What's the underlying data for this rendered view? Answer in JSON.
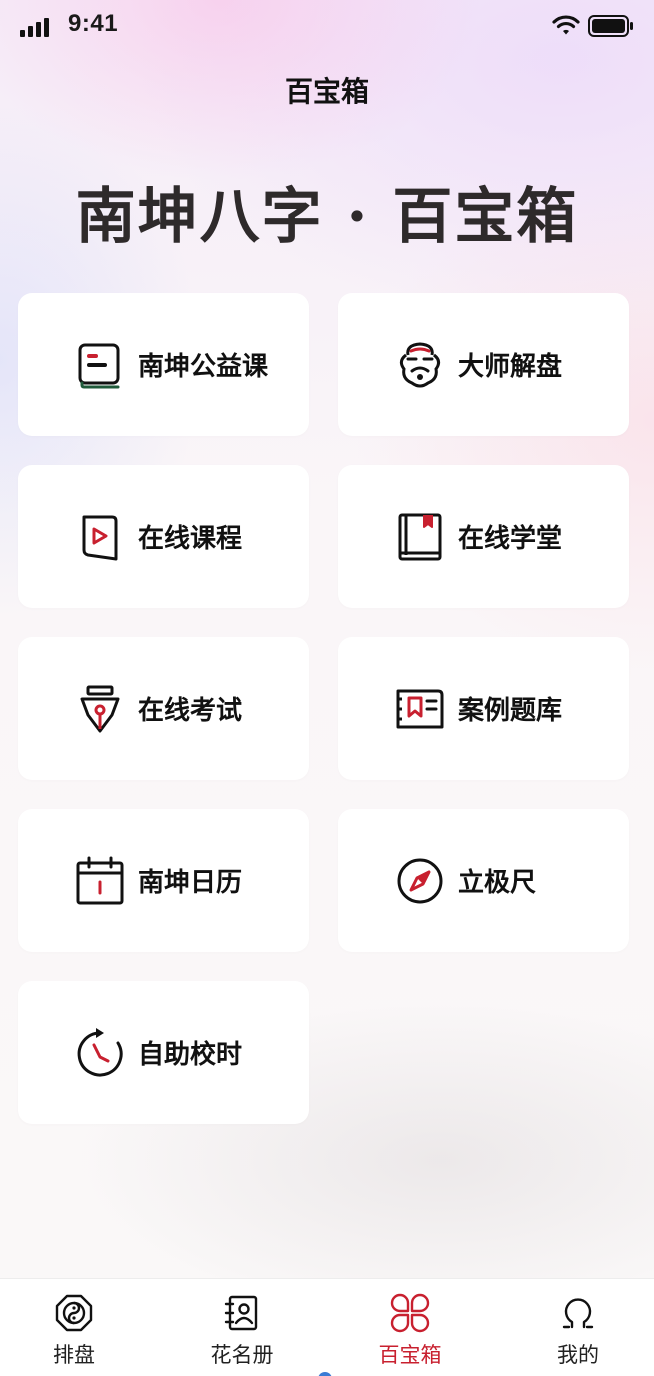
{
  "status_bar": {
    "time": "9:41"
  },
  "header": {
    "title": "百宝箱"
  },
  "hero": {
    "title": "南坤八字 · 百宝箱"
  },
  "colors": {
    "accent": "#c8202f",
    "text": "#111111",
    "hero_text": "#2e2a2b",
    "card_bg": "#ffffff"
  },
  "grid": {
    "items": [
      {
        "label": "南坤公益课",
        "icon": "book-green-icon"
      },
      {
        "label": "大师解盘",
        "icon": "master-face-icon"
      },
      {
        "label": "在线课程",
        "icon": "video-course-icon"
      },
      {
        "label": "在线学堂",
        "icon": "bookmark-book-icon"
      },
      {
        "label": "在线考试",
        "icon": "pen-nib-icon"
      },
      {
        "label": "案例题库",
        "icon": "question-bank-icon"
      },
      {
        "label": "南坤日历",
        "icon": "calendar-icon"
      },
      {
        "label": "立极尺",
        "icon": "compass-icon"
      },
      {
        "label": "自助校时",
        "icon": "clock-refresh-icon"
      }
    ]
  },
  "tabbar": {
    "tabs": [
      {
        "label": "排盘",
        "icon": "bagua-icon",
        "active": false
      },
      {
        "label": "花名册",
        "icon": "contacts-icon",
        "active": false
      },
      {
        "label": "百宝箱",
        "icon": "grid-flower-icon",
        "active": true
      },
      {
        "label": "我的",
        "icon": "profile-icon",
        "active": false
      }
    ]
  }
}
